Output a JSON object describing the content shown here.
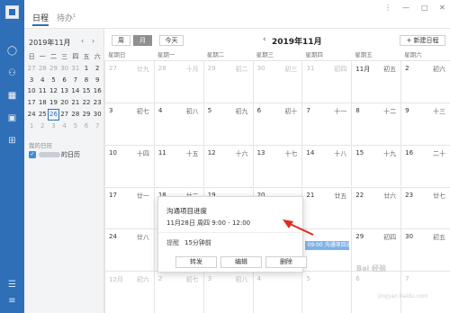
{
  "tabs": [
    {
      "label": "日程"
    },
    {
      "label": "待办",
      "badge": "1"
    }
  ],
  "window": {
    "settings_glyph": "⋮",
    "minimize_glyph": "—",
    "maximize_glyph": "□",
    "close_glyph": "✕"
  },
  "mini_calendar": {
    "title": "2019年11月",
    "prev": "‹",
    "next": "›",
    "weekdays": [
      "日",
      "一",
      "二",
      "三",
      "四",
      "五",
      "六"
    ],
    "weeks": [
      [
        "27",
        "28",
        "29",
        "30",
        "31",
        "1",
        "2"
      ],
      [
        "3",
        "4",
        "5",
        "6",
        "7",
        "8",
        "9"
      ],
      [
        "10",
        "11",
        "12",
        "13",
        "14",
        "15",
        "16"
      ],
      [
        "17",
        "18",
        "19",
        "20",
        "21",
        "22",
        "23"
      ],
      [
        "24",
        "25",
        "26",
        "27",
        "28",
        "29",
        "30"
      ],
      [
        "1",
        "2",
        "3",
        "4",
        "5",
        "6",
        "7"
      ]
    ]
  },
  "my_calendars": {
    "heading": "我的日历",
    "items": [
      {
        "label": "的日历",
        "checked": true
      }
    ]
  },
  "toolbar": {
    "week_label": "周",
    "month_label": "月",
    "today_label": "今天",
    "month_title": "2019年11月",
    "prev": "‹",
    "next": "›",
    "new_event_label": "+ 新建日程"
  },
  "weekdays": [
    "星期日",
    "星期一",
    "星期二",
    "星期三",
    "星期四",
    "星期五",
    "星期六"
  ],
  "month_grid": [
    [
      {
        "d": "27",
        "l": "廿九",
        "m": true
      },
      {
        "d": "28",
        "l": "十月",
        "m": true
      },
      {
        "d": "29",
        "l": "初二",
        "m": true
      },
      {
        "d": "30",
        "l": "初三",
        "m": true
      },
      {
        "d": "31",
        "l": "初四",
        "m": true
      },
      {
        "d": "11月",
        "l": "初五"
      },
      {
        "d": "2",
        "l": "初六"
      }
    ],
    [
      {
        "d": "3",
        "l": "初七"
      },
      {
        "d": "4",
        "l": "初八"
      },
      {
        "d": "5",
        "l": "初九"
      },
      {
        "d": "6",
        "l": "初十"
      },
      {
        "d": "7",
        "l": "十一"
      },
      {
        "d": "8",
        "l": "十二"
      },
      {
        "d": "9",
        "l": "十三"
      }
    ],
    [
      {
        "d": "10",
        "l": "十四"
      },
      {
        "d": "11",
        "l": "十五"
      },
      {
        "d": "12",
        "l": "十六"
      },
      {
        "d": "13",
        "l": "十七"
      },
      {
        "d": "14",
        "l": "十八"
      },
      {
        "d": "15",
        "l": "十九"
      },
      {
        "d": "16",
        "l": "二十"
      }
    ],
    [
      {
        "d": "17",
        "l": "廿一"
      },
      {
        "d": "18",
        "l": "廿二"
      },
      {
        "d": "19",
        "l": ""
      },
      {
        "d": "20",
        "l": ""
      },
      {
        "d": "21",
        "l": "廿五"
      },
      {
        "d": "22",
        "l": "廿六"
      },
      {
        "d": "23",
        "l": "廿七"
      }
    ],
    [
      {
        "d": "24",
        "l": "廿八"
      },
      {
        "d": "",
        "l": ""
      },
      {
        "d": "",
        "l": ""
      },
      {
        "d": "",
        "l": ""
      },
      {
        "d": "",
        "l": ""
      },
      {
        "d": "29",
        "l": "初四"
      },
      {
        "d": "30",
        "l": "初五"
      }
    ],
    [
      {
        "d": "12月",
        "l": "初六",
        "m": true
      },
      {
        "d": "2",
        "l": "初七",
        "m": true
      },
      {
        "d": "3",
        "l": "初八",
        "m": true
      },
      {
        "d": "4",
        "l": "",
        "m": true
      },
      {
        "d": "5",
        "l": "",
        "m": true
      },
      {
        "d": "6",
        "l": "",
        "m": true
      },
      {
        "d": "7",
        "l": "",
        "m": true
      }
    ]
  ],
  "event": {
    "label": "09:00 沟通项目进"
  },
  "popup": {
    "title": "沟通项目进度",
    "time": "11月28日 周四 9:00 - 12:00",
    "remind_label": "提醒",
    "remind_value": "15分钟前",
    "forward_label": "转发",
    "edit_label": "编辑",
    "delete_label": "删除"
  },
  "watermark": {
    "text": "Bai 经验",
    "sub": "jingyan.baidu.com"
  }
}
